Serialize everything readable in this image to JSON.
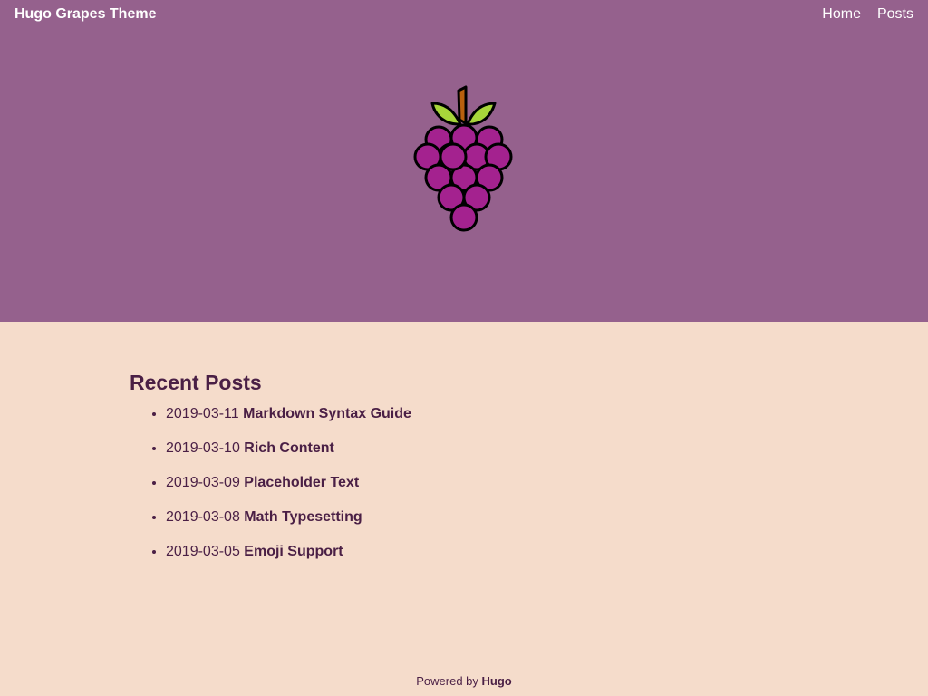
{
  "header": {
    "site_title": "Hugo Grapes Theme",
    "nav": [
      {
        "label": "Home"
      },
      {
        "label": "Posts"
      }
    ],
    "logo_icon": "grapes-icon"
  },
  "colors": {
    "hero_bg": "#95618d",
    "page_bg": "#f5dccb",
    "text": "#4a1f45",
    "grape": "#a4228f",
    "leaf": "#a8d53a",
    "stem": "#b8600e"
  },
  "main": {
    "section_title": "Recent Posts",
    "posts": [
      {
        "date": "2019-03-11",
        "title": "Markdown Syntax Guide"
      },
      {
        "date": "2019-03-10",
        "title": "Rich Content"
      },
      {
        "date": "2019-03-09",
        "title": "Placeholder Text"
      },
      {
        "date": "2019-03-08",
        "title": "Math Typesetting"
      },
      {
        "date": "2019-03-05",
        "title": "Emoji Support"
      }
    ]
  },
  "footer": {
    "prefix": "Powered by",
    "link": "Hugo"
  }
}
